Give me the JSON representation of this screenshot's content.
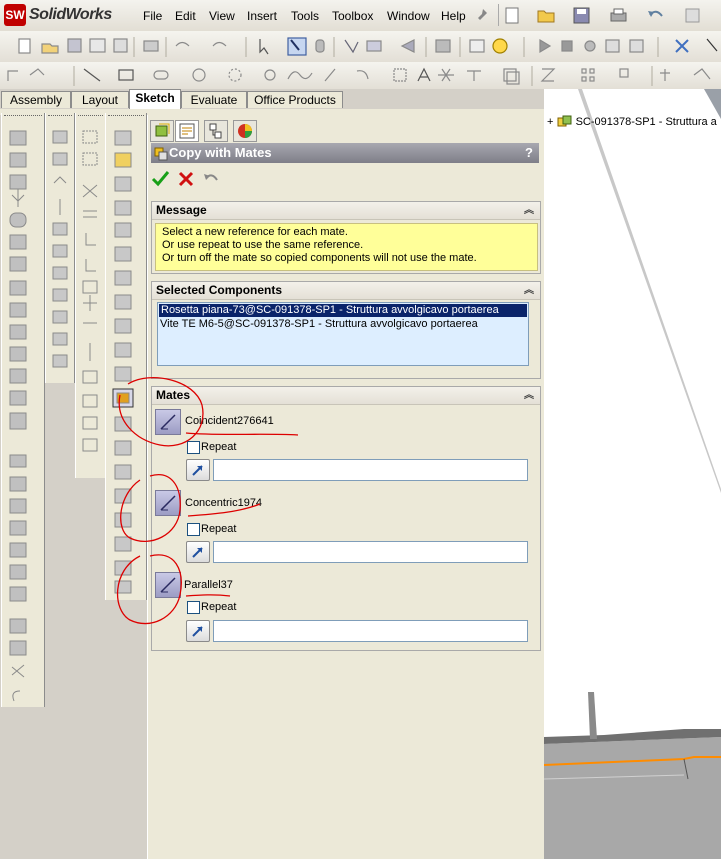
{
  "app": {
    "name": "SolidWorks",
    "logo_mark": "SW"
  },
  "menu": [
    "File",
    "Edit",
    "View",
    "Insert",
    "Tools",
    "Toolbox",
    "Window",
    "Help"
  ],
  "tabs": [
    "Assembly",
    "Layout",
    "Sketch",
    "Evaluate",
    "Office Products"
  ],
  "active_tab": "Sketch",
  "property_manager": {
    "title": "Copy with Mates",
    "help": "?",
    "message": {
      "title": "Message",
      "lines": [
        "Select a new reference for each mate.",
        "Or use repeat to use the same reference.",
        "Or turn off the mate so copied components will not use the mate."
      ]
    },
    "selected_components": {
      "title": "Selected Components",
      "items": [
        "Rosetta piana-73@SC-091378-SP1 - Struttura avvolgicavo portaerea",
        "Vite TE M6-5@SC-091378-SP1 - Struttura avvolgicavo portaerea"
      ]
    },
    "mates": {
      "title": "Mates",
      "repeat_label": "Repeat",
      "items": [
        {
          "name": "Coincident276641"
        },
        {
          "name": "Concentric1974"
        },
        {
          "name": "Parallel37"
        }
      ]
    }
  },
  "feature_tree": {
    "root": "SC-091378-SP1 - Struttura a",
    "expand": "+"
  },
  "colors": {
    "annotation": "#dd0000",
    "selection": "#0a246a",
    "message_bg": "#ffff99",
    "list_bg": "#ddeeff"
  }
}
